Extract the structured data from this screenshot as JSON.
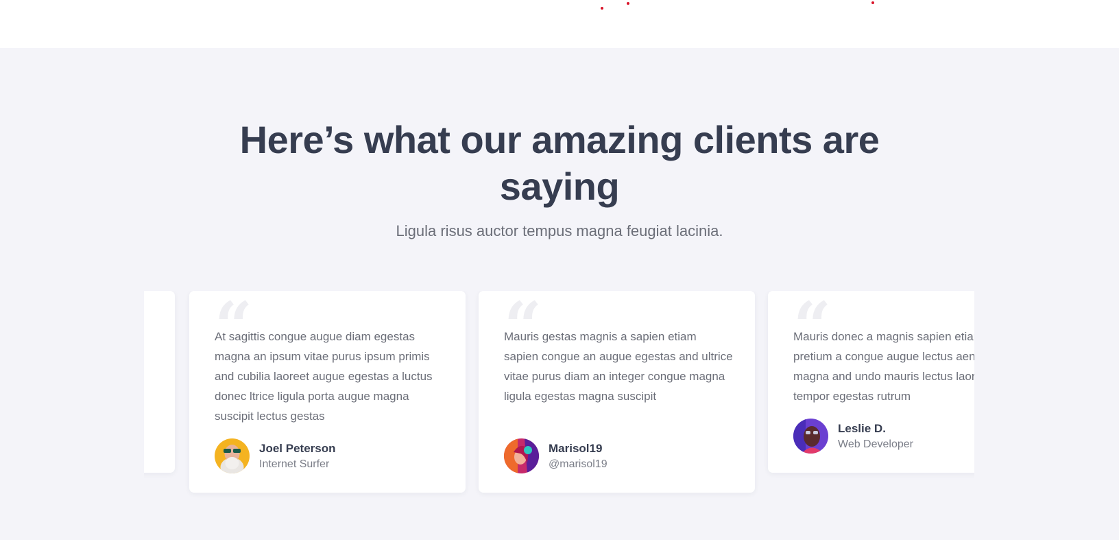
{
  "heading": {
    "title": "Here’s what our amazing clients are saying",
    "subtitle": "Ligula risus auctor tempus magna feugiat lacinia."
  },
  "colors": {
    "section_bg": "#f4f4f9",
    "title": "#363d50",
    "body_text": "#6b6e78",
    "accent_dot": "#d9152a",
    "card_bg": "#ffffff"
  },
  "testimonials": [
    {
      "quote": "At sagittis congue augue diam egestas magna an ipsum vitae purus ipsum primis and cubilia laoreet augue egestas a luctus donec ltrice ligula porta augue magna suscipit lectus gestas",
      "name": "Joel Peterson",
      "role": "Internet Surfer",
      "avatar_icon": "avatar-man-sunglasses"
    },
    {
      "quote": "Mauris gestas magnis a sapien etiam sapien congue an augue egestas and ultrice vitae purus diam an integer congue magna ligula egestas magna suscipit",
      "name": "Marisol19",
      "role": "@marisol19",
      "avatar_icon": "avatar-woman-headphones"
    },
    {
      "quote": "Mauris donec a magnis sapien etiam pretium a congue augue lectus aenean magna and undo mauris lectus laoreet tempor egestas rutrum",
      "name": "Leslie D.",
      "role": "Web Developer",
      "avatar_icon": "avatar-man-portrait"
    }
  ]
}
